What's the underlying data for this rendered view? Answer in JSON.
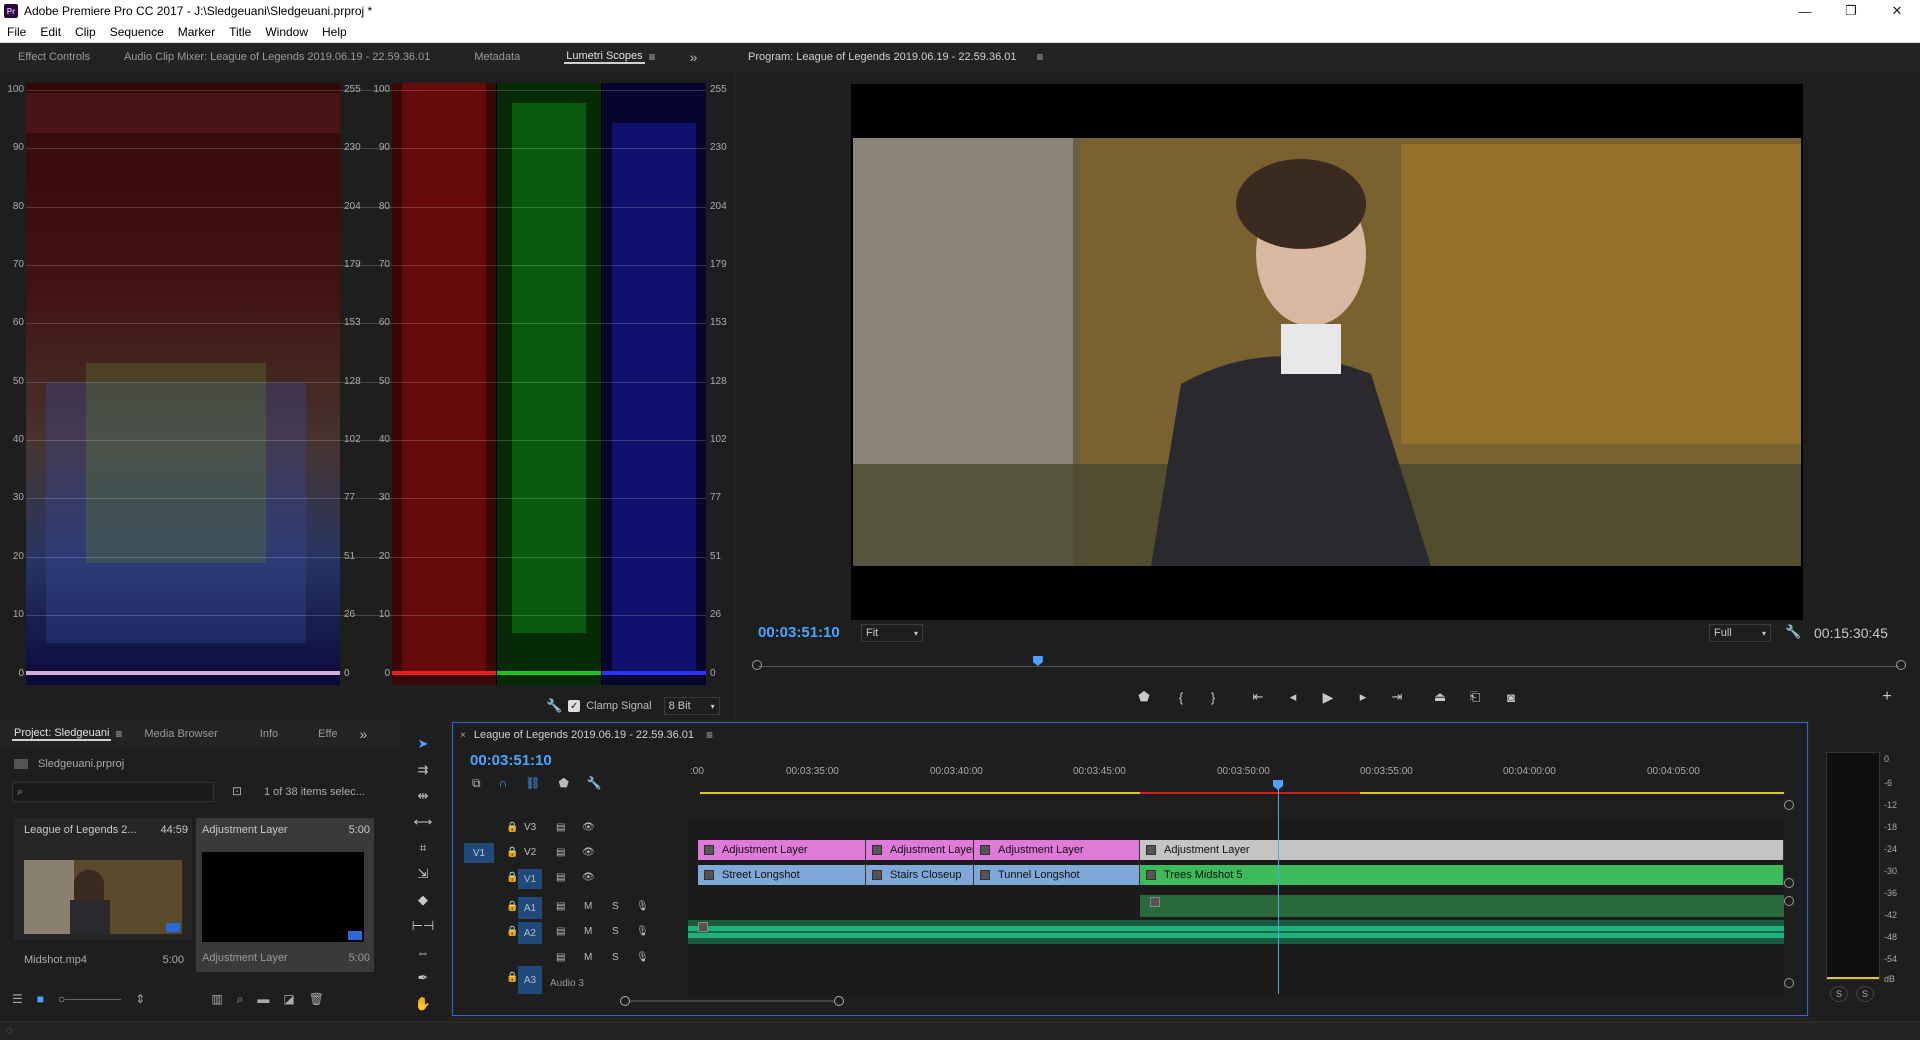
{
  "window": {
    "title": "Adobe Premiere Pro CC 2017 - J:\\Sledgeuani\\Sledgeuani.prproj *",
    "logo": "Pr",
    "minimize": "—",
    "maximize": "❐",
    "close": "✕"
  },
  "menu": [
    "File",
    "Edit",
    "Clip",
    "Sequence",
    "Marker",
    "Title",
    "Window",
    "Help"
  ],
  "scopes_panel": {
    "tabs": [
      "Effect Controls",
      "Audio Clip Mixer: League of Legends 2019.06.19 - 22.59.36.01",
      "Metadata",
      "Lumetri Scopes"
    ],
    "active_tab": "Lumetri Scopes",
    "left_scale": [
      "100",
      "90",
      "80",
      "70",
      "60",
      "50",
      "40",
      "30",
      "20",
      "10",
      "0"
    ],
    "right_scale": [
      "255",
      "230",
      "204",
      "179",
      "153",
      "128",
      "102",
      "77",
      "51",
      "26",
      "0"
    ],
    "clamp_signal_label": "Clamp Signal",
    "clamp_signal_checked": true,
    "bit_depth": "8 Bit"
  },
  "program_monitor": {
    "title": "Program: League of Legends 2019.06.19 - 22.59.36.01",
    "current_timecode": "00:03:51:10",
    "zoom": "Fit",
    "resolution": "Full",
    "duration": "00:15:30:45",
    "playhead_fraction": 0.245
  },
  "project_panel": {
    "tabs": [
      "Project: Sledgeuani",
      "Media Browser",
      "Info",
      "Effe"
    ],
    "project_file": "Sledgeuani.prproj",
    "search_placeholder": "",
    "selection_info": "1 of 38 items selec...",
    "items": [
      {
        "name": "League of Legends 2...",
        "duration": "44:59"
      },
      {
        "name": "Adjustment Layer",
        "duration": "5:00"
      }
    ],
    "thumbs": [
      {
        "name": "Midshot.mp4",
        "duration": "5:00"
      },
      {
        "name": "Adjustment Layer",
        "duration": "5:00"
      }
    ]
  },
  "timeline": {
    "tab": "League of Legends 2019.06.19 - 22.59.36.01",
    "timecode": "00:03:51:10",
    "ruler": [
      ":00",
      "00:03:35:00",
      "00:03:40:00",
      "00:03:45:00",
      "00:03:50:00",
      "00:03:55:00",
      "00:04:00:00",
      "00:04:05:00"
    ],
    "tracks": {
      "v3": "V3",
      "v2": "V2",
      "v1": "V1",
      "a1": "A1",
      "a2": "A2",
      "a3": "A3",
      "src_v1": "V1",
      "mute": "M",
      "solo": "S",
      "audio3_name": "Audio 3"
    },
    "v2_clips": [
      "Adjustment Layer",
      "Adjustment Layer",
      "Adjustment Layer",
      "Adjustment Layer"
    ],
    "v1_clips": [
      "Street Longshot",
      "Stairs Closeup",
      "Tunnel Longshot",
      "Trees Midshot 5"
    ]
  },
  "audio_meter": {
    "scale": [
      "0",
      "-6",
      "-12",
      "-18",
      "-24",
      "-30",
      "-36",
      "-42",
      "-48",
      "-54",
      "dB"
    ],
    "solo_buttons": [
      "S",
      "S"
    ]
  },
  "colors": {
    "accent": "#4aa3ff",
    "adjustment": "#e07ad8",
    "video_clip": "#7fa8d8",
    "trees_clip": "#3fba5a",
    "audio": "#1fb07a"
  }
}
